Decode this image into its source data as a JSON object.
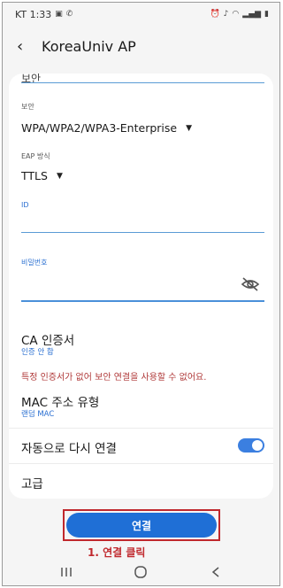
{
  "status_bar": {
    "carrier_time": "KT 1:33",
    "left_icons": [
      "gallery-icon",
      "call-icon"
    ],
    "right_icons": [
      "alarm-icon",
      "mute-icon",
      "wifi-icon",
      "signal-icon",
      "battery-icon"
    ]
  },
  "header": {
    "title": "KoreaUniv AP"
  },
  "form": {
    "peek_label": "보안",
    "security": {
      "label": "보안",
      "value": "WPA/WPA2/WPA3-Enterprise"
    },
    "eap": {
      "label": "EAP 방식",
      "value": "TTLS"
    },
    "id_field": {
      "label": "ID",
      "value": ""
    },
    "password_field": {
      "label": "비밀번호",
      "value": ""
    },
    "ca_cert": {
      "title": "CA 인증서",
      "value": "인증 안 함"
    },
    "warning": "특정 인증서가 없어 보안 연결을 사용할 수 없어요.",
    "mac": {
      "title": "MAC 주소 유형",
      "value": "랜덤 MAC"
    },
    "auto_reconnect": {
      "title": "자동으로 다시 연결",
      "enabled": true
    },
    "advanced": {
      "title": "고급"
    }
  },
  "connect_button": {
    "label": "연결"
  },
  "annotation": {
    "text": "1. 연결 클릭",
    "color": "#c0282d"
  },
  "colors": {
    "accent": "#1f6fd6",
    "underline": "#5a9bd5",
    "warning": "#b03a3a"
  }
}
